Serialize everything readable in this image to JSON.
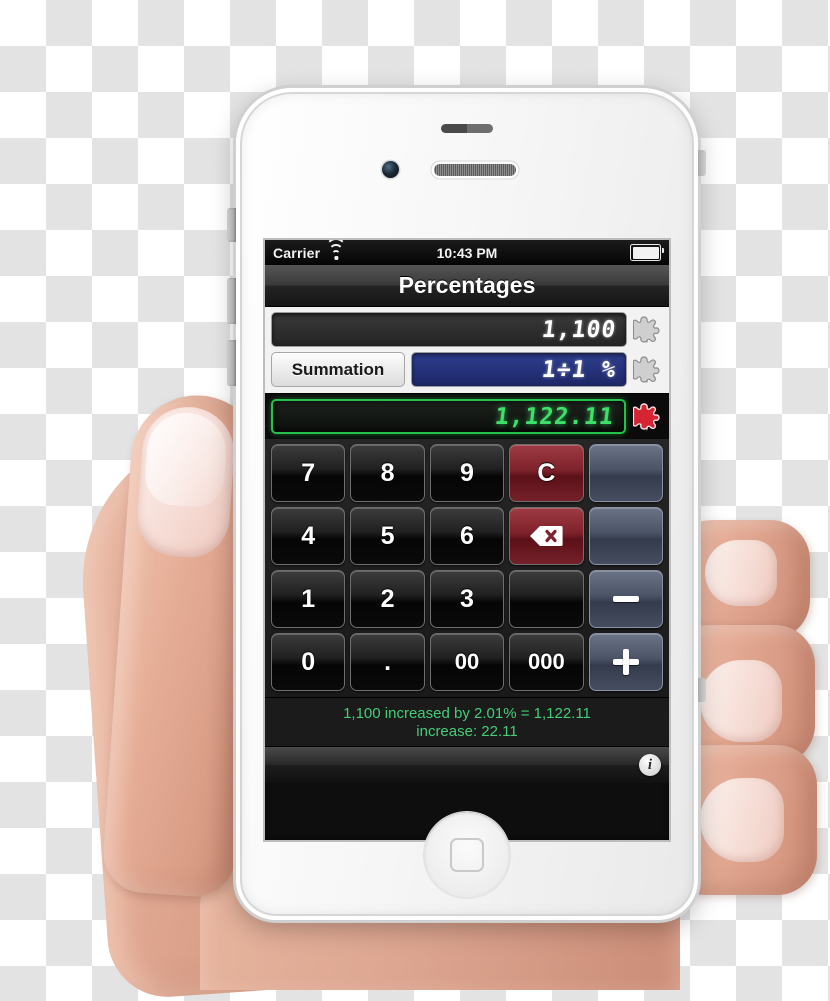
{
  "device": {
    "name": "white-smartphone",
    "sensor_label": "proximity-sensor",
    "camera_label": "front-camera",
    "speaker_label": "earpiece-speaker",
    "home_label": "home-button"
  },
  "status_bar": {
    "carrier": "Carrier",
    "wifi_icon": "wifi-icon",
    "time": "10:43 PM",
    "battery_icon": "battery-icon"
  },
  "title_bar": {
    "title": "Percentages"
  },
  "inputs": {
    "row1": {
      "value": "1,100",
      "icon": "puzzle-icon"
    },
    "row2": {
      "button_label": "Summation",
      "value": "1÷1 %",
      "icon": "puzzle-icon"
    }
  },
  "result": {
    "value": "1,122.11",
    "icon": "puzzle-icon-red"
  },
  "keypad": {
    "keys": [
      {
        "label": "7",
        "style": "key-dark",
        "icon": ""
      },
      {
        "label": "8",
        "style": "key-dark",
        "icon": ""
      },
      {
        "label": "9",
        "style": "key-dark",
        "icon": ""
      },
      {
        "label": "C",
        "style": "key-red",
        "icon": ""
      },
      {
        "label": "",
        "style": "key-slate",
        "icon": ""
      },
      {
        "label": "4",
        "style": "key-dark",
        "icon": ""
      },
      {
        "label": "5",
        "style": "key-dark",
        "icon": ""
      },
      {
        "label": "6",
        "style": "key-dark",
        "icon": ""
      },
      {
        "label": "",
        "style": "key-red",
        "icon": "backspace-icon"
      },
      {
        "label": "",
        "style": "key-slate",
        "icon": ""
      },
      {
        "label": "1",
        "style": "key-dark",
        "icon": ""
      },
      {
        "label": "2",
        "style": "key-dark",
        "icon": ""
      },
      {
        "label": "3",
        "style": "key-dark",
        "icon": ""
      },
      {
        "label": "",
        "style": "key-dark",
        "icon": ""
      },
      {
        "label": "",
        "style": "key-slate",
        "icon": "minus-icon"
      },
      {
        "label": "0",
        "style": "key-dark",
        "icon": ""
      },
      {
        "label": ".",
        "style": "key-dark",
        "icon": ""
      },
      {
        "label": "00",
        "style": "key-dark",
        "icon": ""
      },
      {
        "label": "000",
        "style": "key-dark",
        "icon": ""
      },
      {
        "label": "",
        "style": "key-slate",
        "icon": "plus-icon"
      }
    ]
  },
  "footer": {
    "line1": "1,100 increased by 2.01% = 1,122.11",
    "line2": "increase: 22.11",
    "info_label": "i"
  },
  "colors": {
    "result_green": "#3ee06a",
    "operator_blue": "#2f3d8e",
    "clear_red": "#7e222b",
    "footer_green": "#45cc77"
  }
}
